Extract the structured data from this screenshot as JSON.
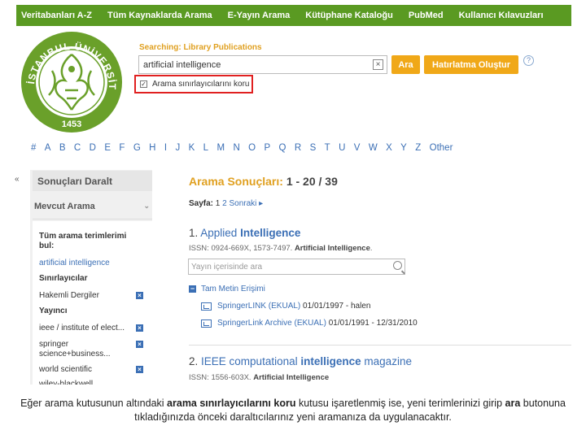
{
  "topnav": [
    "Veritabanları A-Z",
    "Tüm Kaynaklarda Arama",
    "E-Yayın Arama",
    "Kütüphane Kataloğu",
    "PubMed",
    "Kullanıcı Kılavuzları"
  ],
  "logo": {
    "ring_text": "T.C. İSTANBUL ÜNİVERSİTESİ",
    "year": "1453",
    "color": "#6aa02a"
  },
  "search": {
    "label": "Searching: Library Publications",
    "value": "artificial intelligence",
    "button": "Ara",
    "alert_button": "Hatırlatma Oluştur",
    "help": "?",
    "keep_limiters": "Arama sınırlayıcılarını koru"
  },
  "alphabet": [
    "#",
    "A",
    "B",
    "C",
    "D",
    "E",
    "F",
    "G",
    "H",
    "I",
    "J",
    "K",
    "L",
    "M",
    "N",
    "O",
    "P",
    "Q",
    "R",
    "S",
    "T",
    "U",
    "V",
    "W",
    "X",
    "Y",
    "Z",
    "Other"
  ],
  "sidebar": {
    "collapse": "«",
    "refine": "Sonuçları Daralt",
    "current_search": "Mevcut Arama",
    "all_terms_1": "Tüm arama terimlerimi",
    "all_terms_2": "bul:",
    "query": "artificial intelligence",
    "limiters": "Sınırlayıcılar",
    "limiter_item": "Hakemli Dergiler",
    "publisher": "Yayıncı",
    "publishers": [
      "ieee / institute of elect...",
      "springer",
      "science+business...",
      "world scientific",
      "wiley-blackwell"
    ]
  },
  "results": {
    "heading": "Arama Sonuçları:",
    "range": "1 - 20 / 39",
    "page_label": "Sayfa:",
    "page_1": "1",
    "page_2": "2",
    "next": "Sonraki",
    "items": [
      {
        "num": "1.",
        "title_pre": "Applied",
        "title_bold": "Intelligence",
        "title_post": "",
        "issn": "ISSN: 0924-669X, 1573-7497.",
        "issn_bold": "Artificial Intelligence",
        "issn_tail": "."
      },
      {
        "num": "2.",
        "title_pre": "IEEE computational",
        "title_bold": "intelligence",
        "title_post": "magazine",
        "issn": "ISSN: 1556-603X.",
        "issn_bold": "Artificial Intelligence",
        "issn_tail": ""
      }
    ],
    "search_within": "Yayın içerisinde ara",
    "full_text": "Tam Metin Erişimi",
    "links": [
      {
        "name": "SpringerLINK (EKUAL)",
        "dates": "01/01/1997 - halen"
      },
      {
        "name": "SpringerLink Archive (EKUAL)",
        "dates": "01/01/1991 - 12/31/2010"
      }
    ]
  },
  "caption": {
    "p1": "Eğer arama kutusunun altındaki",
    "b1": "arama sınırlayıcılarını koru",
    "p2": "kutusu işaretlenmiş ise, yeni terimlerinizi girip",
    "b2": "ara",
    "p3": "butonuna tıkladığınızda önceki daraltıcılarınız yeni aramanıza da uygulanacaktır."
  },
  "colors": {
    "nav": "#5a9a22",
    "accent": "#f0a818",
    "link": "#3b6fb5",
    "highlight": "#e02020"
  }
}
